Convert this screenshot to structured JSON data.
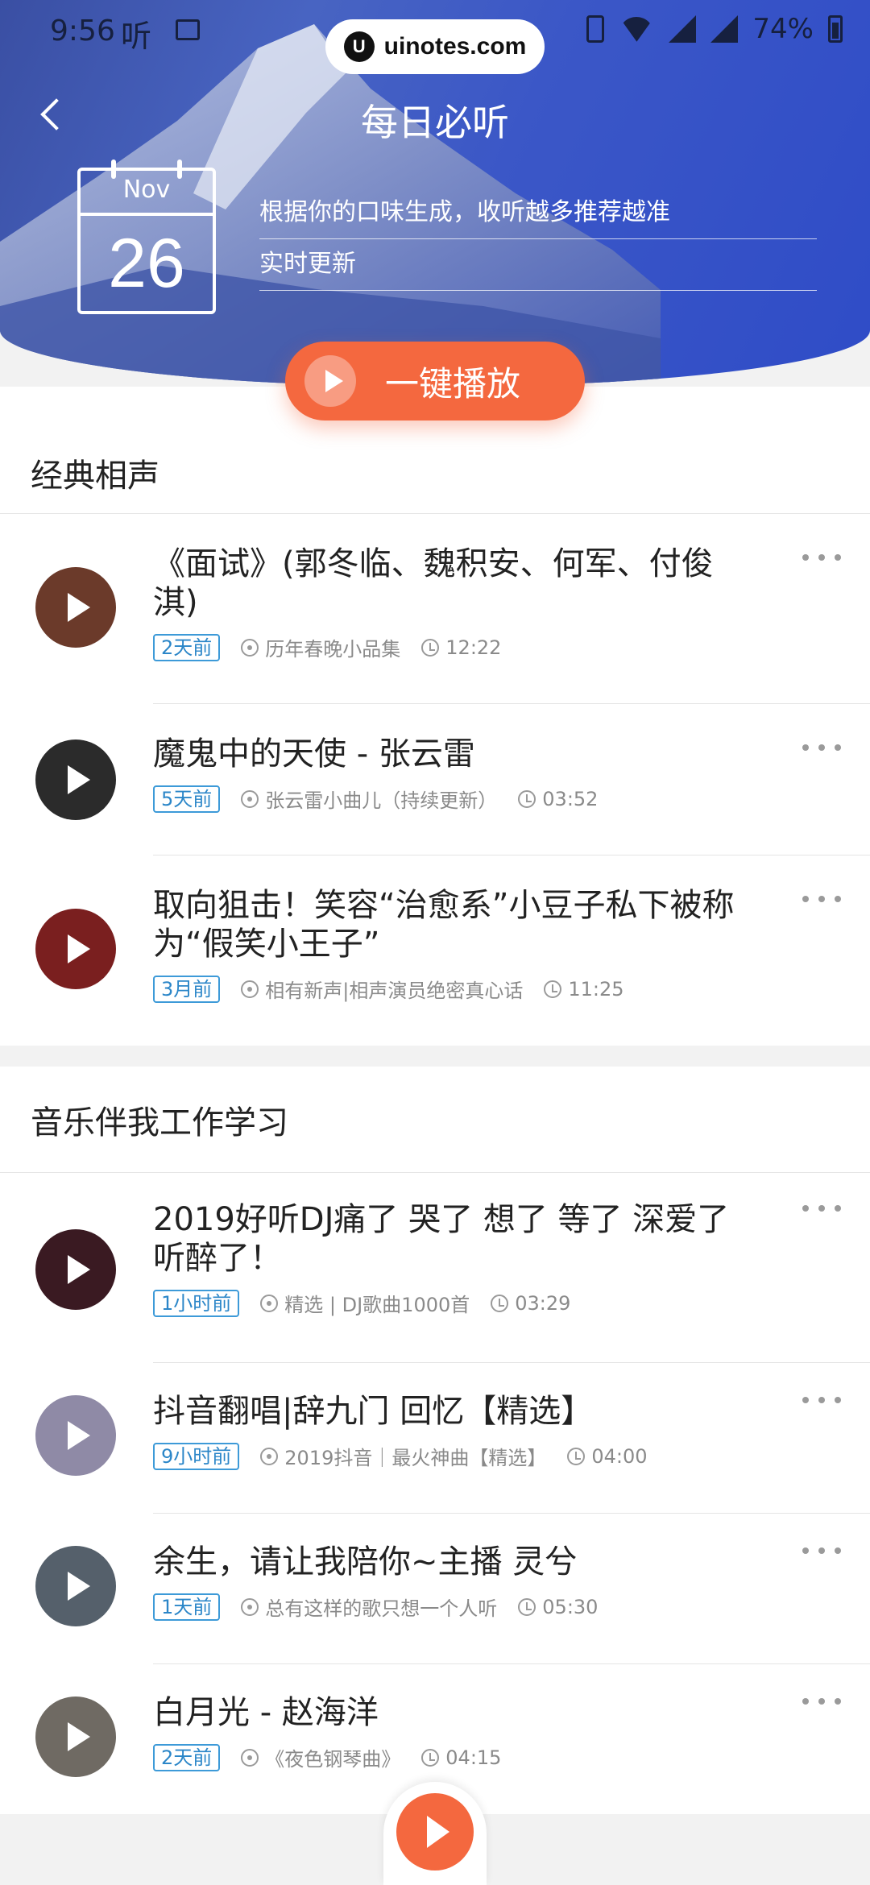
{
  "status_bar": {
    "time": "9:56",
    "app_icon_text": "听",
    "battery": "74%"
  },
  "watermark": {
    "logo": "U",
    "text": "uinotes.com"
  },
  "header": {
    "title": "每日必听",
    "calendar_month": "Nov",
    "calendar_day": "26",
    "line1": "根据你的口味生成，收听越多推荐越准",
    "line2": "实时更新",
    "play_all_label": "一键播放"
  },
  "sections": [
    {
      "title": "经典相声",
      "items": [
        {
          "title": "《面试》(郭冬临、魏积安、何军、付俊淇)",
          "tag": "2天前",
          "album": "历年春晚小品集",
          "duration": "12:22",
          "cover_color": "#6b3a2a"
        },
        {
          "title": "魔鬼中的天使 - 张云雷",
          "tag": "5天前",
          "album": "张云雷小曲儿（持续更新）",
          "duration": "03:52",
          "cover_color": "#2b2b2b"
        },
        {
          "title": "取向狙击！笑容“治愈系”小豆子私下被称为“假笑小王子”",
          "tag": "3月前",
          "album": "相有新声|相声演员绝密真心话",
          "duration": "11:25",
          "cover_color": "#7a1f1f"
        }
      ]
    },
    {
      "title": "音乐伴我工作学习",
      "items": [
        {
          "title": "2019好听DJ痛了 哭了 想了 等了 深爱了 听醉了！",
          "tag": "1小时前",
          "album": "精选 | DJ歌曲1000首",
          "duration": "03:29",
          "cover_color": "#3a1a22"
        },
        {
          "title": "抖音翻唱|辞九门 回忆【精选】",
          "tag": "9小时前",
          "album": "2019抖音｜最火神曲【精选】",
          "duration": "04:00",
          "cover_color": "#8f8aa6"
        },
        {
          "title": "余生，请让我陪你~主播 灵兮",
          "tag": "1天前",
          "album": "总有这样的歌只想一个人听",
          "duration": "05:30",
          "cover_color": "#55606b"
        },
        {
          "title": "白月光 - 赵海洋",
          "tag": "2天前",
          "album": "《夜色钢琴曲》",
          "duration": "04:15",
          "cover_color": "#6f6a63"
        }
      ]
    }
  ],
  "colors": {
    "accent": "#f4683f",
    "tag_blue": "#2b86c8",
    "header_blue": "#3b57c7"
  }
}
